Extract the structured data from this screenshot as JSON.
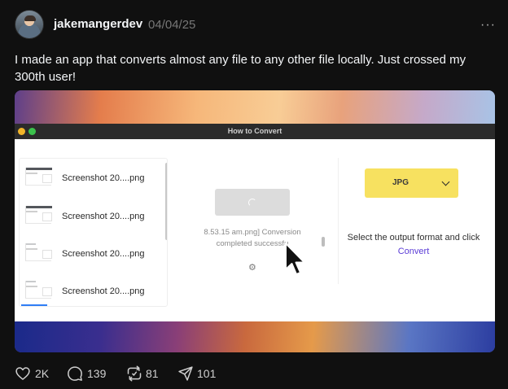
{
  "post": {
    "username": "jakemangerdev",
    "date": "04/04/25",
    "more_label": "···",
    "text": "I made an app that converts almost any file to any other file locally. Just crossed my 300th user!"
  },
  "app": {
    "window_title": "How to Convert",
    "files": [
      {
        "name": "Screenshot 20....png",
        "thumb": "dark"
      },
      {
        "name": "Screenshot 20....png",
        "thumb": "dark"
      },
      {
        "name": "Screenshot 20....png",
        "thumb": "light"
      },
      {
        "name": "Screenshot 20....png",
        "thumb": "light"
      }
    ],
    "status_text": "8.53.15 am.png] Conversion completed successfu",
    "format": "JPG",
    "instructions_prefix": "Select the output format and click ",
    "instructions_link": "Convert",
    "accent_color": "#f7e160",
    "link_color": "#5a3bd6"
  },
  "actions": {
    "likes": "2K",
    "replies": "139",
    "reposts": "81",
    "shares": "101"
  }
}
